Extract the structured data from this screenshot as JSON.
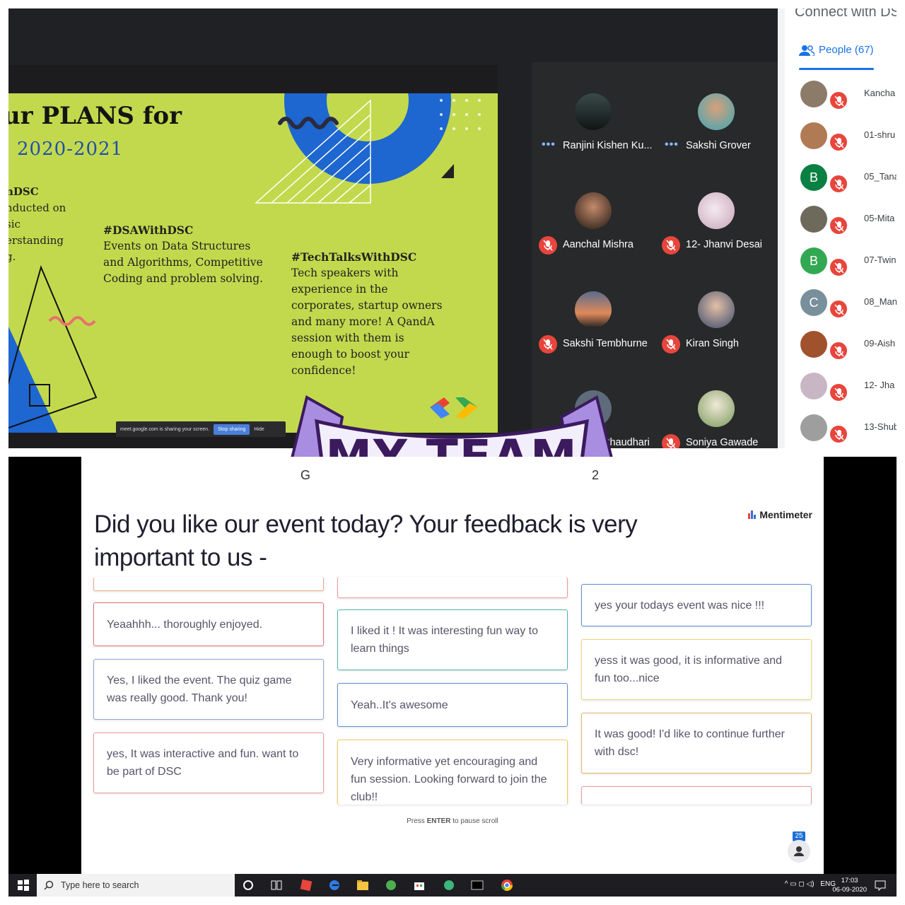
{
  "meet": {
    "header": "Connect with DS",
    "people_tab": "People (67)",
    "share_bar": {
      "message": "meet.google.com is sharing your screen.",
      "stop": "Stop sharing",
      "hide": "Hide"
    },
    "slide": {
      "title": "ur PLANS for",
      "year": "2020-2021",
      "left_col": [
        "nDSC",
        "nducted on",
        "sic",
        "erstanding",
        "g."
      ],
      "col1": {
        "heading": "#DSAWithDSC",
        "body": "Events on Data Structures and Algorithms, Competitive Coding and problem solving."
      },
      "col2": {
        "heading": "#TechTalksWithDSC",
        "body": "Tech speakers with experience in the corporates, startup owners and many more! A QandA session with them is enough to boost your confidence!"
      }
    },
    "participants": [
      {
        "name": "Ranjini Kishen Ku...",
        "status": "speaking"
      },
      {
        "name": "Sakshi Grover",
        "status": "speaking"
      },
      {
        "name": "Aanchal Mishra",
        "status": "muted"
      },
      {
        "name": "12- Jhanvi Desai",
        "status": "muted"
      },
      {
        "name": "Sakshi Tembhurne",
        "status": "muted"
      },
      {
        "name": "Kiran Singh",
        "status": "muted"
      },
      {
        "name": "Chaudhari",
        "status": "muted"
      },
      {
        "name": "Soniya Gawade",
        "status": "muted"
      }
    ],
    "people_list": [
      {
        "name": "Kancha",
        "initial": "",
        "color": "#8d7b6a"
      },
      {
        "name": "01-shru",
        "initial": "",
        "color": "#b07a54"
      },
      {
        "name": "05_Tana",
        "initial": "B",
        "color": "#0b8043"
      },
      {
        "name": "05-Mita",
        "initial": "",
        "color": "#6d6a5c"
      },
      {
        "name": "07-Twin",
        "initial": "B",
        "color": "#33a853"
      },
      {
        "name": "08_Man",
        "initial": "C",
        "color": "#78909c"
      },
      {
        "name": "09-Aish",
        "initial": "",
        "color": "#a0522d"
      },
      {
        "name": "12- Jha",
        "initial": "",
        "color": "#c9b6c4"
      },
      {
        "name": "13-Shub",
        "initial": "",
        "color": "#9e9e9e"
      }
    ]
  },
  "ribbon": {
    "text": "MY TEAM"
  },
  "menti": {
    "peek_left": "G",
    "peek_right": "2",
    "question": "Did you like our event today? Your feedback is very important to us -",
    "brand": "Mentimeter",
    "hint_pre": "Press ",
    "hint_key": "ENTER",
    "hint_post": " to pause scroll",
    "participant_count": "25",
    "responses": [
      {
        "text": "Yeaahhh... thoroughly enjoyed.",
        "color": "#e57373"
      },
      {
        "text": "Yes, I liked the event. The quiz game was really good. Thank you!",
        "color": "#90a4d4"
      },
      {
        "text": "yes, It was interactive and fun. want to be part of DSC",
        "color": "#ef9a9a"
      },
      {
        "text": "I liked it ! It was interesting fun way to learn things",
        "color": "#4db6ac"
      },
      {
        "text": "Yeah..It's awesome",
        "color": "#5c8fd6"
      },
      {
        "text": "Very informative yet encouraging and fun session. Looking forward to join the club!!",
        "color": "#f0c95a"
      },
      {
        "text": "yes your todays event was nice !!!",
        "color": "#5c8fd6"
      },
      {
        "text": "yess it was good, it is informative and fun too...nice",
        "color": "#f0d67a"
      },
      {
        "text": "It was good! I'd like to continue further with dsc!",
        "color": "#e6b46a"
      }
    ]
  },
  "taskbar": {
    "search_placeholder": "Type here to search",
    "lang": "ENG",
    "time": "17:03",
    "date": "06-09-2020"
  }
}
